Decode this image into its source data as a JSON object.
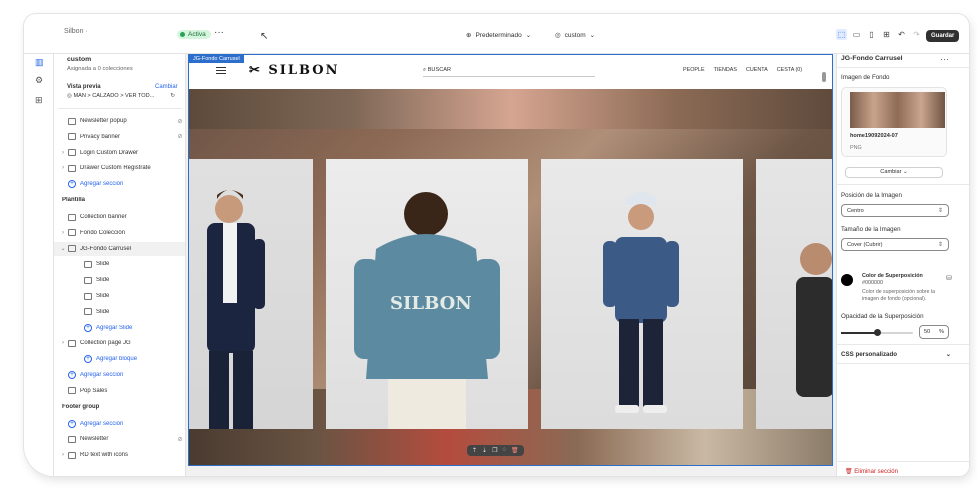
{
  "topbar": {
    "store": "Silbon ·",
    "status": "Activa",
    "more": "···",
    "theme_label": "Predeterminado",
    "template_label": "custom",
    "save_label": "Guardar"
  },
  "left_panel": {
    "title": "custom",
    "subtitle": "Asignada a 0 colecciones",
    "preview_label": "Vista previa",
    "change_label": "Cambiar",
    "preview_path": "MAN > CALZADO > VER TOD...",
    "rows": [
      {
        "label": "Newsletter popup",
        "kind": "item",
        "eye": true
      },
      {
        "label": "Privacy banner",
        "kind": "item",
        "eye": true
      },
      {
        "label": "Login Custom Drawer",
        "kind": "item",
        "chev": true
      },
      {
        "label": "Drawer Custom Registrate",
        "kind": "item",
        "chev": true
      },
      {
        "label": "Agregar sección",
        "kind": "add"
      },
      {
        "label": "Plantilla",
        "kind": "head"
      },
      {
        "label": "Collection banner",
        "kind": "item"
      },
      {
        "label": "Fondo Colección",
        "kind": "item",
        "chev": true
      },
      {
        "label": "JG-Fondo Carrusel",
        "kind": "item",
        "chev": true,
        "selected": true
      },
      {
        "label": "Slide",
        "kind": "sub"
      },
      {
        "label": "Slide",
        "kind": "sub"
      },
      {
        "label": "Slide",
        "kind": "sub"
      },
      {
        "label": "Slide",
        "kind": "sub"
      },
      {
        "label": "Agregar Slide",
        "kind": "addsub"
      },
      {
        "label": "Collection page JG",
        "kind": "item",
        "chev": true
      },
      {
        "label": "Agregar bloque",
        "kind": "addsub"
      },
      {
        "label": "Agregar sección",
        "kind": "add"
      },
      {
        "label": "Pop Sales",
        "kind": "item"
      },
      {
        "label": "Footer group",
        "kind": "head"
      },
      {
        "label": "Agregar sección",
        "kind": "add"
      },
      {
        "label": "Newsletter",
        "kind": "item",
        "eye": true
      },
      {
        "label": "RD text with icons",
        "kind": "item",
        "chev": true
      }
    ]
  },
  "preview": {
    "badge": "JG-Fondo Carrusel",
    "logo": "SILBON",
    "search_placeholder": "BUSCAR",
    "nav": [
      "PEOPLE",
      "TIENDAS",
      "CUENTA",
      "CESTA (0)"
    ]
  },
  "right_panel": {
    "title": "JG-Fondo Carrusel",
    "bg_image_label": "Imagen de Fondo",
    "image_name": "home19092024-07",
    "image_type": "PNG",
    "change_button": "Cambiar",
    "position_label": "Posición de la Imagen",
    "position_value": "Centro",
    "size_label": "Tamaño de la Imagen",
    "size_value": "Cover (Cubrir)",
    "overlay_title": "Color de Superposición",
    "overlay_hex": "#000000",
    "overlay_desc": "Color de superposición sobre la imagen de fondo (opcional).",
    "opacity_label": "Opacidad de la Superposición",
    "opacity_value": "50",
    "opacity_unit": "%",
    "css_label": "CSS personalizado",
    "delete_label": "Eliminar sección"
  },
  "colors": {
    "accent": "#2c6ecb",
    "save_bg": "#303030",
    "active_bg": "#d6f5dd"
  }
}
